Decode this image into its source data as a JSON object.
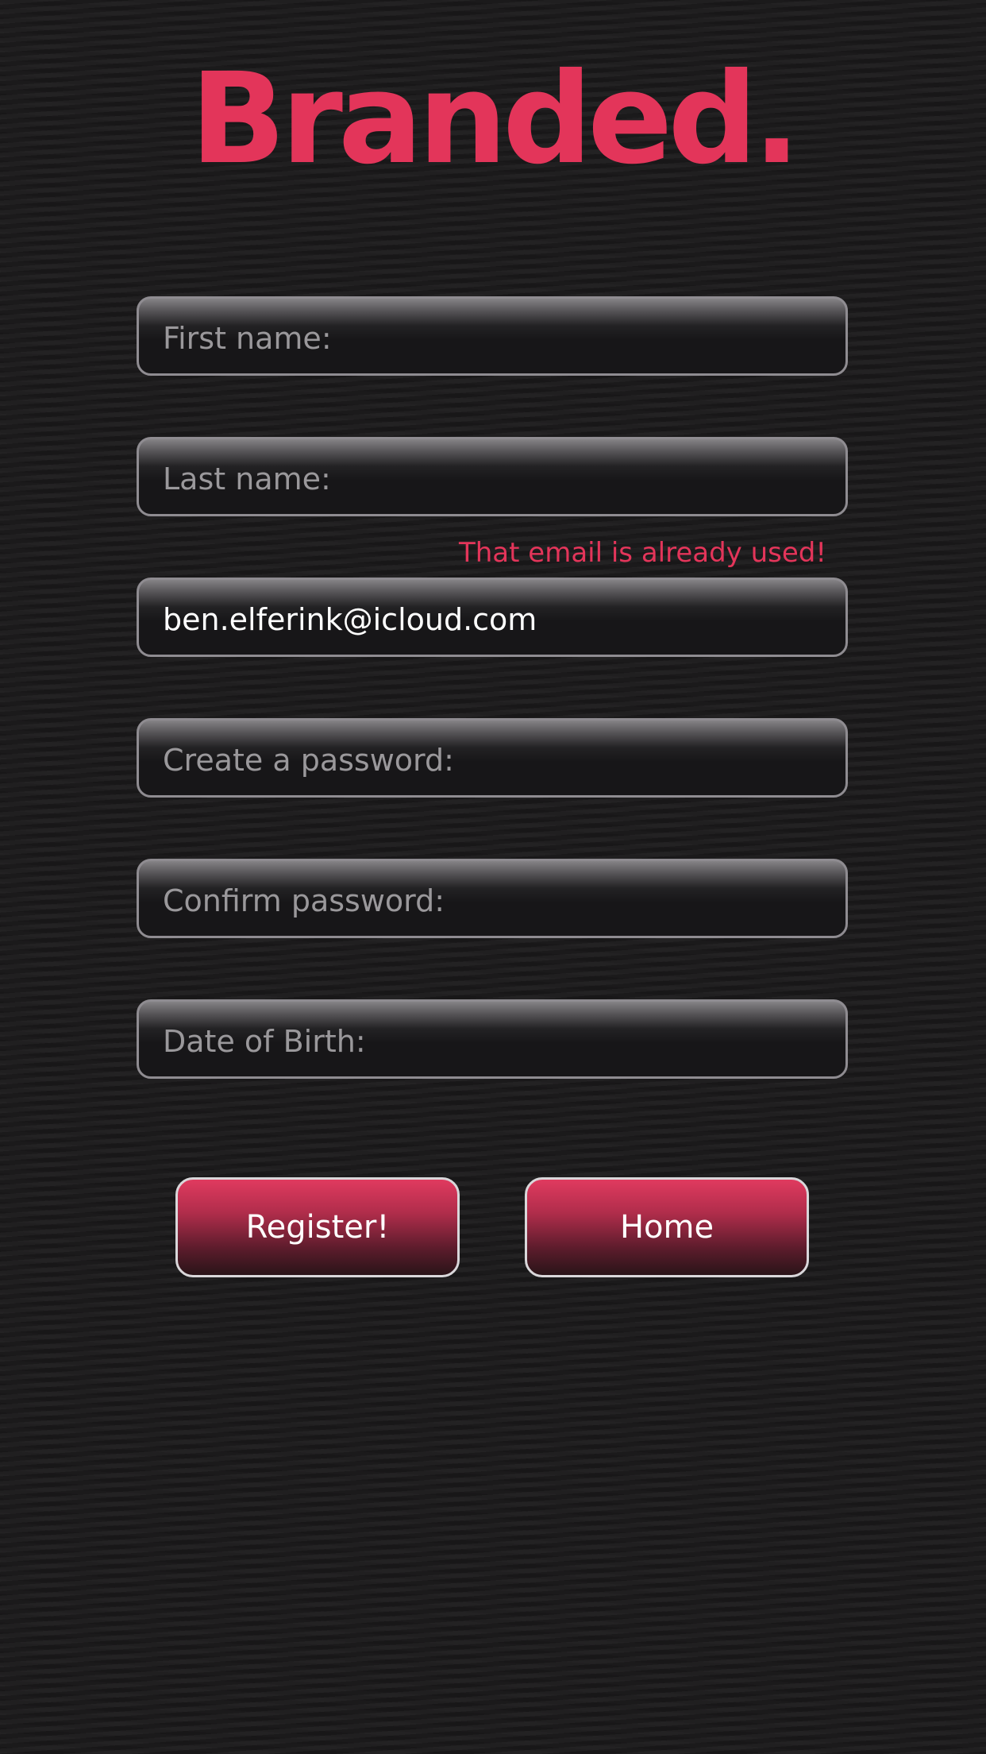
{
  "logo": {
    "text": "Branded."
  },
  "form": {
    "first_name": {
      "placeholder": "First name:",
      "value": ""
    },
    "last_name": {
      "placeholder": "Last name:",
      "value": ""
    },
    "email": {
      "placeholder": "",
      "value": "ben.elferink@icloud.com",
      "error": "That email is already used!"
    },
    "password": {
      "placeholder": "Create a password:",
      "value": ""
    },
    "confirm_password": {
      "placeholder": "Confirm password:",
      "value": ""
    },
    "dob": {
      "placeholder": "Date of Birth:",
      "value": ""
    }
  },
  "buttons": {
    "register": "Register!",
    "home": "Home"
  },
  "colors": {
    "accent": "#e3355a",
    "background": "#1b1a1b",
    "field_border": "#8f8c91"
  }
}
